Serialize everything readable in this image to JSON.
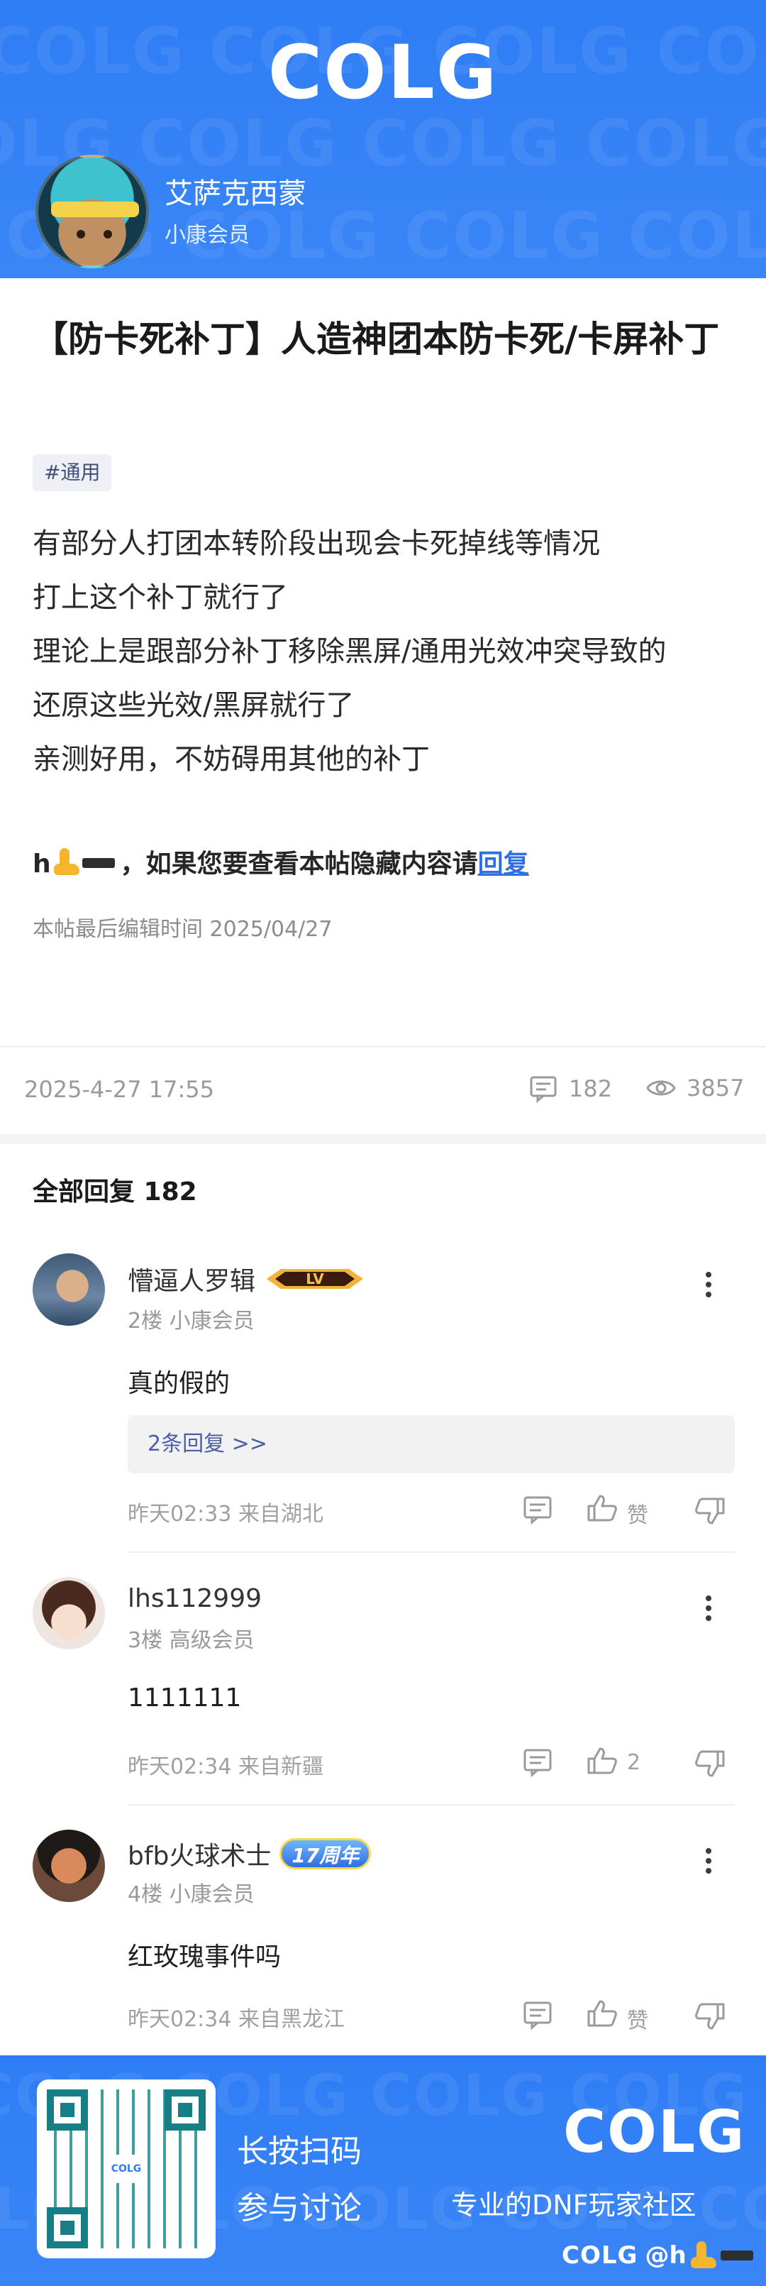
{
  "header": {
    "logo": "COLG",
    "author_name": "艾萨克西蒙",
    "author_level": "小康会员"
  },
  "post": {
    "title": "【防卡死补丁】人造神团本防卡死/卡屏补丁",
    "tag": "#通用",
    "body": [
      "有部分人打团本转阶段出现会卡死掉线等情况",
      "打上这个补丁就行了",
      "理论上是跟部分补丁移除黑屏/通用光效冲突导致的",
      "还原这些光效/黑屏就行了",
      "亲测好用，不妨碍用其他的补丁"
    ],
    "hidden_prefix": "h",
    "hidden_text": "，如果您要查看本帖隐藏内容请",
    "hidden_link": "回复",
    "edit_time": "本帖最后编辑时间 2025/04/27",
    "time": "2025-4-27 17:55",
    "comments_count": "182",
    "views_count": "3857"
  },
  "replies": {
    "header": "全部回复  182",
    "items": [
      {
        "name": "懵逼人罗辑",
        "badge": "LV",
        "floor": "2楼  小康会员",
        "text": "真的假的",
        "sub_replies": "2条回复 >>",
        "meta": "昨天02:33 来自湖北",
        "like": "赞"
      },
      {
        "name": "lhs112999",
        "floor": "3楼  高级会员",
        "text": "1111111",
        "meta": "昨天02:34 来自新疆",
        "like": "2"
      },
      {
        "name": "bfb火球术士",
        "badge": "17周年",
        "floor": "4楼  小康会员",
        "text": "红玫瑰事件吗",
        "meta": "昨天02:34 来自黑龙江",
        "like": "赞"
      }
    ]
  },
  "footer": {
    "scan_line1": "长按扫码",
    "scan_line2": "参与讨论",
    "logo": "COLG",
    "slogan": "专业的DNF玩家社区",
    "watermark_logo": "COLG",
    "watermark_user": "@h"
  },
  "colors": {
    "brand_blue": "#2f7df5",
    "link_blue": "#2f6fe3"
  }
}
